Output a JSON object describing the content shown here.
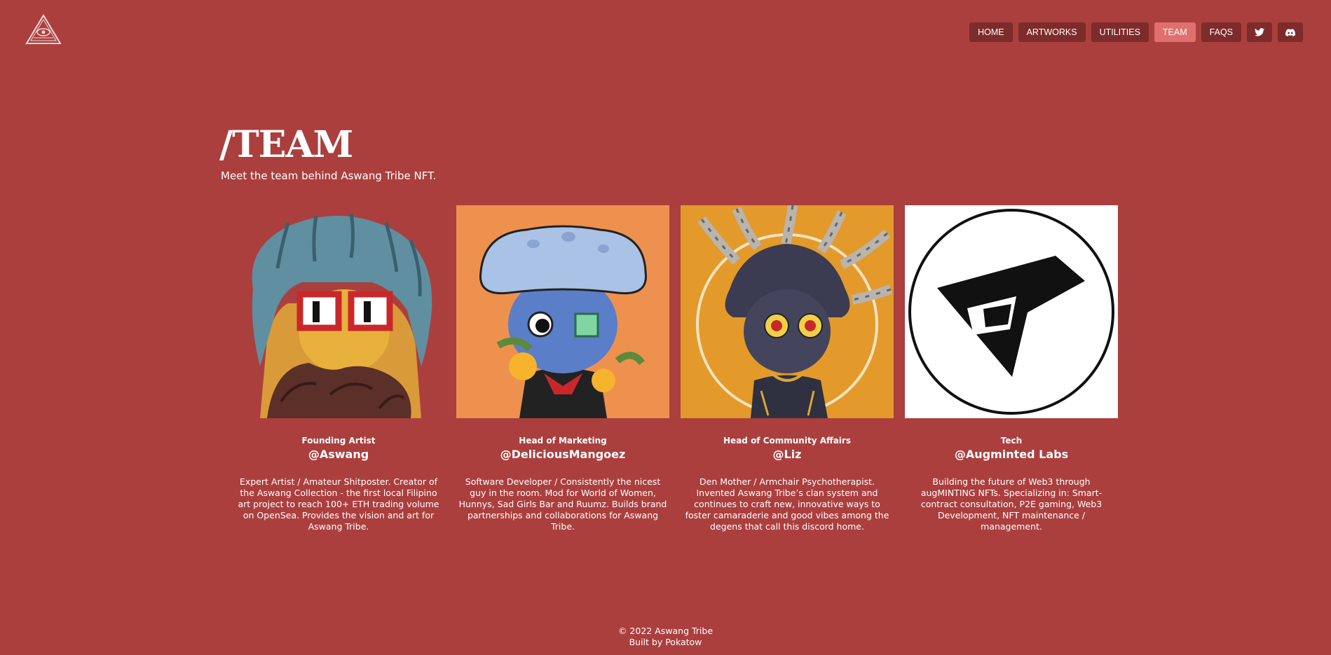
{
  "brand": {
    "logo_icon": "all-seeing-eye-pyramid-icon"
  },
  "nav": {
    "items": [
      {
        "label": "HOME"
      },
      {
        "label": "ARTWORKS"
      },
      {
        "label": "UTILITIES"
      },
      {
        "label": "TEAM"
      },
      {
        "label": "FAQS"
      }
    ],
    "social": [
      {
        "icon": "twitter-icon"
      },
      {
        "icon": "discord-icon"
      }
    ],
    "active": "TEAM"
  },
  "page": {
    "title": "/TEAM",
    "subtitle": "Meet the team behind Aswang Tribe NFT."
  },
  "team": [
    {
      "role": "Founding Artist",
      "handle": "@Aswang",
      "description": "Expert Artist / Amateur Shitposter. Creator of the Aswang Collection - the first local Filipino art project to reach 100+ ETH trading volume on OpenSea. Provides the vision and art for Aswang Tribe.",
      "avatar_icon": "aswang-avatar-icon"
    },
    {
      "role": "Head of Marketing",
      "handle": "@DeliciousMangoez",
      "description": "Software Developer / Consistently the nicest guy in the room. Mod for World of Women, Hunnys, Sad Girls Bar and Ruumz. Builds brand partnerships and collaborations for Aswang Tribe.",
      "avatar_icon": "cat-mushroom-avatar-icon"
    },
    {
      "role": "Head of Community Affairs",
      "handle": "@Liz",
      "description": "Den Mother / Armchair Psychotherapist. Invented Aswang Tribe’s clan system and continues to craft new, innovative ways to foster camaraderie and good vibes among the degens that call this discord home.",
      "avatar_icon": "tentacle-head-avatar-icon"
    },
    {
      "role": "Tech",
      "handle": "@Augminted Labs",
      "description": "Building the future of Web3 through augMINTING NFTs. Specializing in: Smart-contract consultation, P2E gaming, Web3 Development, NFT maintenance / management.",
      "avatar_icon": "augminted-logo-icon"
    }
  ],
  "footer": {
    "copyright": "© 2022 Aswang Tribe",
    "credit": "Built by Pokatow"
  }
}
